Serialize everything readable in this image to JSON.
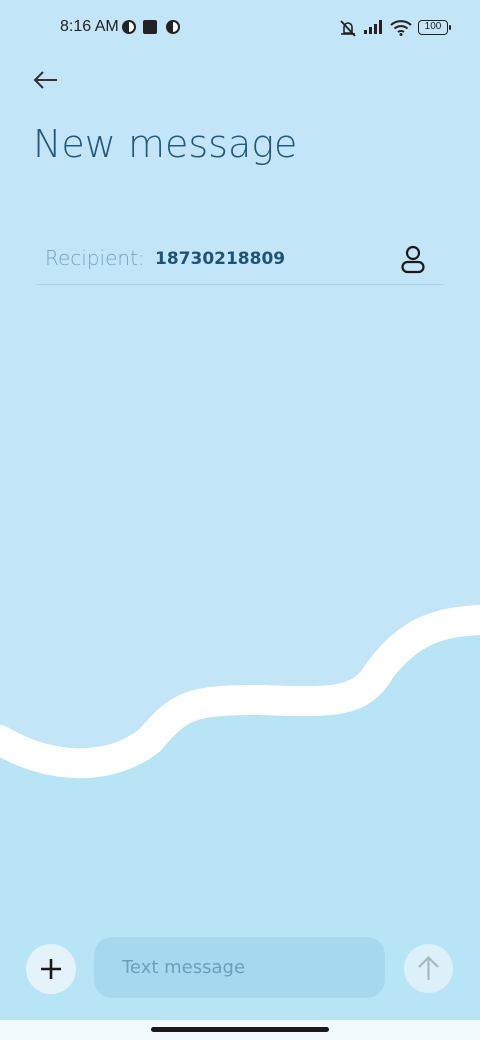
{
  "status_bar": {
    "time": "8:16 AM",
    "battery_level": "100",
    "icons": [
      "notification-dot-icon",
      "stop-square-icon",
      "notification-dot-icon",
      "mute-vibrate-icon",
      "signal-icon",
      "wifi-icon",
      "battery-icon"
    ]
  },
  "header": {
    "title": "New message",
    "back_icon": "arrow-left-icon"
  },
  "recipient": {
    "label": "Recipient:",
    "value": "18730218809",
    "contact_icon": "person-icon"
  },
  "compose": {
    "placeholder": "Text message",
    "add_icon": "plus-icon",
    "send_icon": "arrow-up-icon"
  },
  "colors": {
    "background": "#c3e5f8",
    "background_lower": "#b8e5f6",
    "wave": "#ffffff",
    "title": "#22597a",
    "input_bg": "#a7d9ee"
  }
}
